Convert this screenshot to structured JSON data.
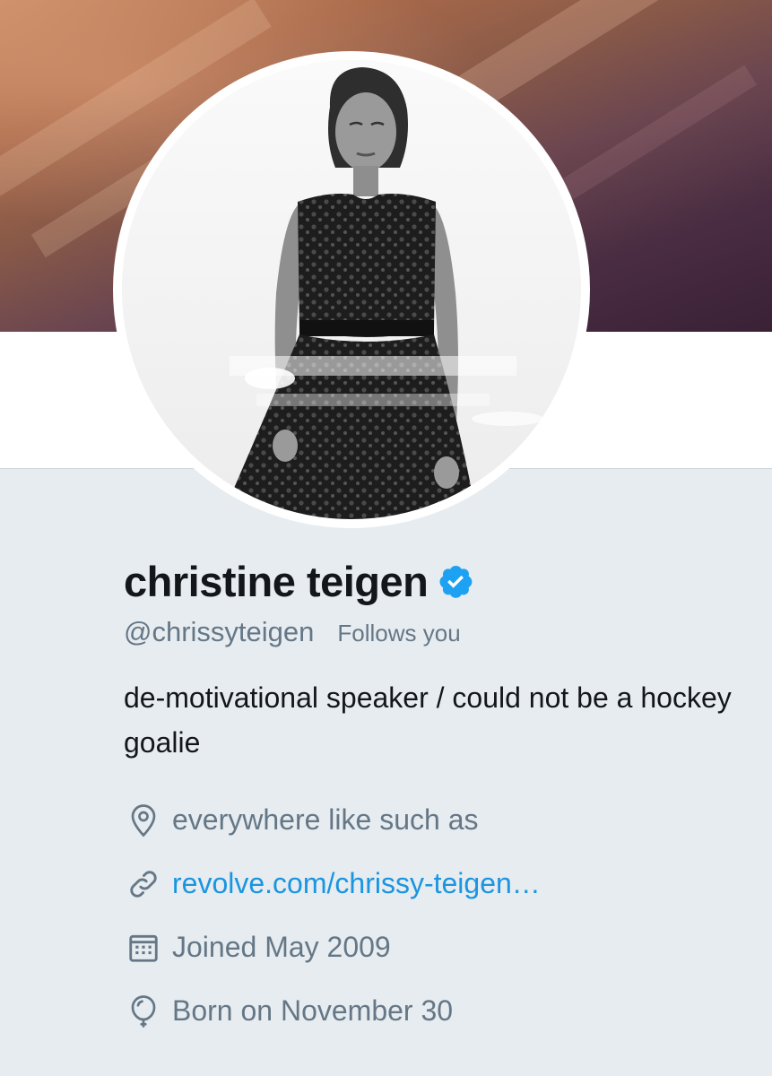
{
  "profile": {
    "name": "christine teigen",
    "verified": true,
    "handle": "@chrissyteigen",
    "follows_you": "Follows you",
    "bio": "de-motivational speaker / could not be a hockey goalie",
    "location": "everywhere like such as",
    "website": "revolve.com/chrissy-teigen…",
    "joined": "Joined May 2009",
    "birthday": "Born on November 30"
  },
  "icons": {
    "verified": "verified-badge-icon",
    "location": "location-pin-icon",
    "website": "link-icon",
    "joined": "calendar-icon",
    "birthday": "balloon-icon"
  },
  "colors": {
    "background": "#e6ecf0",
    "text_primary": "#14171a",
    "text_secondary": "#657786",
    "link": "#1b95e0",
    "verified": "#1da1f2"
  }
}
